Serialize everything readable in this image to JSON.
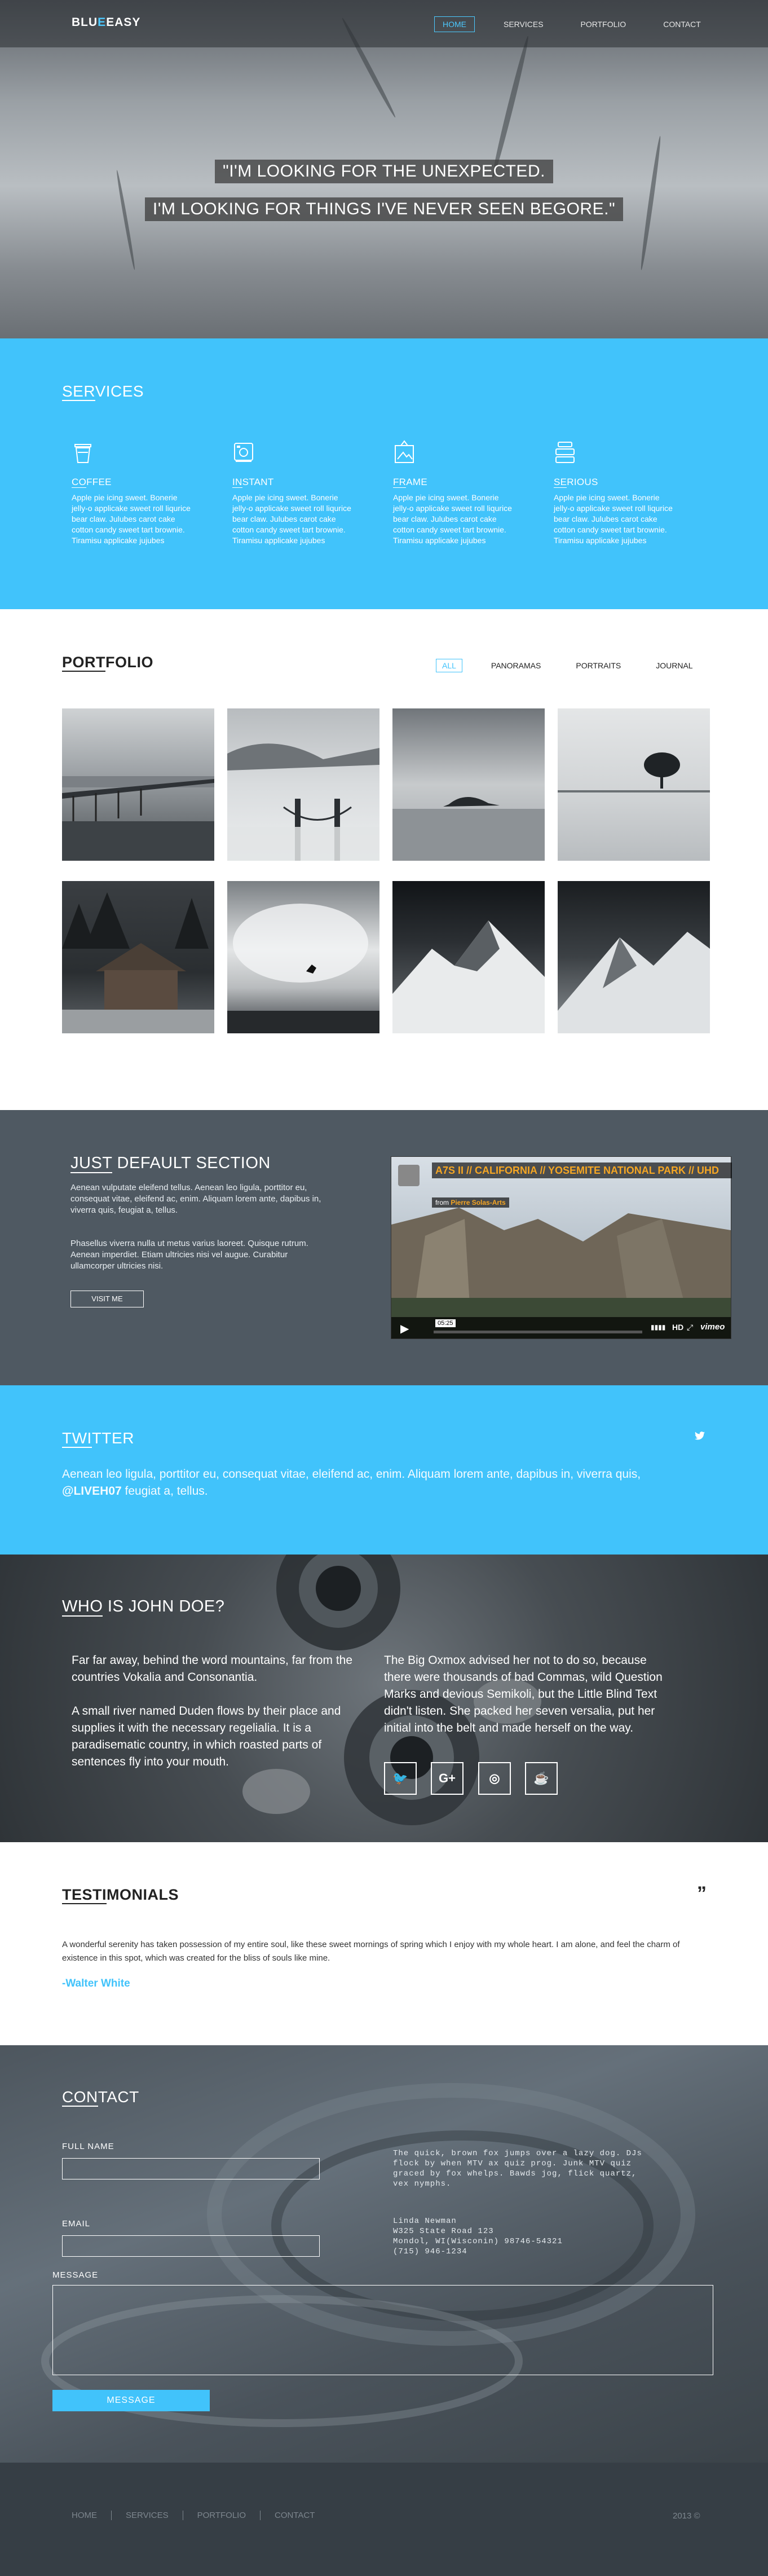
{
  "brand": {
    "logo_part1": "BLU",
    "logo_accent": "E",
    "logo_part2": "EASY",
    "accent_color": "#41c3fb",
    "dark_color": "#4f5962"
  },
  "nav": {
    "items": [
      "HOME",
      "SERVICES",
      "PORTFOLIO",
      "CONTACT"
    ],
    "active": "HOME"
  },
  "hero": {
    "line1": "\"I'M LOOKING FOR THE UNEXPECTED.",
    "line2": "I'M LOOKING FOR THINGS I'VE NEVER SEEN BEGORE.\""
  },
  "services": {
    "title_ul": "SER",
    "title_rest": "VICES",
    "items": [
      {
        "icon": "coffee-cup-icon",
        "title_ul": "CO",
        "title_rest": "FFEE",
        "text": "Apple pie icing sweet. Bonerie jelly-o applicake sweet roll liqurice bear claw. Julubes carot cake cotton candy sweet tart brownie. Tiramisu applicake jujubes"
      },
      {
        "icon": "camera-icon",
        "title_ul": "IN",
        "title_rest": "STANT",
        "text": "Apple pie icing sweet. Bonerie jelly-o applicake sweet roll liqurice bear claw. Julubes carot cake cotton candy sweet tart brownie. Tiramisu applicake jujubes"
      },
      {
        "icon": "frame-icon",
        "title_ul": "FR",
        "title_rest": "AME",
        "text": "Apple pie icing sweet. Bonerie jelly-o applicake sweet roll liqurice bear claw. Julubes carot cake cotton candy sweet tart brownie. Tiramisu applicake jujubes"
      },
      {
        "icon": "stack-icon",
        "title_ul": "SE",
        "title_rest": "RIOUS",
        "text": "Apple pie icing sweet. Bonerie jelly-o applicake sweet roll liqurice bear claw. Julubes carot cake cotton candy sweet tart brownie. Tiramisu applicake jujubes"
      }
    ]
  },
  "portfolio": {
    "title_ul": "PORT",
    "title_rest": "FOLIO",
    "filters": [
      "ALL",
      "PANORAMAS",
      "PORTRAITS",
      "JOURNAL"
    ],
    "active_filter": "ALL",
    "images": [
      "pier-landscape",
      "golden-gate-fog",
      "island-lake",
      "tree-lake",
      "cabin-forest",
      "surfer-wave",
      "snowy-peaks-1",
      "snowy-peaks-2"
    ]
  },
  "default_section": {
    "title_ul": "JUST",
    "title_rest": " DEFAULT SECTION",
    "p1": "Aenean vulputate eleifend tellus. Aenean leo ligula, porttitor eu, consequat vitae, eleifend ac, enim. Aliquam lorem ante, dapibus in, viverra quis, feugiat a, tellus.",
    "p2": "Phasellus viverra nulla ut metus varius laoreet. Quisque rutrum. Aenean imperdiet. Etiam ultricies nisi vel augue. Curabitur ullamcorper ultricies nisi.",
    "button": "VISIT ME",
    "video": {
      "title": "A7S II // CALIFORNIA // YOSEMITE NATIONAL PARK // UHD",
      "from_label": "from",
      "author": "Pierre Solas-Arts",
      "time": "05:25",
      "hd": "HD",
      "brand": "vimeo"
    }
  },
  "twitter": {
    "title_ul": "TWI",
    "title_rest": "TTER",
    "tweet_before": "Aenean leo ligula, porttitor eu, consequat vitae, eleifend ac, enim. Aliquam lorem ante, dapibus in, viverra quis,",
    "tweet_handle": "@LIVEH07",
    "tweet_after": " feugiat a, tellus."
  },
  "about": {
    "title_ul": "WHO",
    "title_rest": " IS JOHN DOE?",
    "col1_p1": "Far far away, behind the word mountains, far from the countries Vokalia and Consonantia.",
    "col1_p2": "A small river named Duden flows by their place and supplies it with the necessary regelialia. It is a paradisematic country, in which roasted parts of sentences fly into your mouth.",
    "col2_p1": "The Big Oxmox advised her not to do so, because there were thousands of bad Commas, wild Question Marks and devious Semikoli, but the Little Blind Text didn't listen. She packed her seven versalia, put her initial into the belt and made herself on the way.",
    "socials": [
      {
        "icon": "twitter-icon",
        "glyph": "🐦"
      },
      {
        "icon": "google-plus-icon",
        "glyph": "G+"
      },
      {
        "icon": "dribbble-icon",
        "glyph": "◎"
      },
      {
        "icon": "coffee-icon",
        "glyph": "☕"
      }
    ]
  },
  "testimonials": {
    "title_ul": "TESTI",
    "title_rest": "MONIALS",
    "quote_glyph": "”",
    "text": "A wonderful serenity has taken possession of my entire soul, like these sweet mornings of spring which I enjoy with my whole heart. I am alone, and feel the charm of existence in this spot, which was created for the bliss of souls like mine.",
    "author": "-Walter White"
  },
  "contact": {
    "title_ul": "CON",
    "title_rest": "TACT",
    "full_name_label": "FULL NAME",
    "email_label": "EMAIL",
    "message_label": "MESSAGE",
    "blurb": "The quick, brown fox jumps over a lazy dog. DJs flock by when MTV ax quiz prog. Junk MTV quiz graced by fox whelps. Bawds jog, flick quartz, vex nymphs.",
    "address_lines": [
      "Linda Newman",
      "W325 State Road 123",
      "Mondol, WI(Wisconin) 98746-54321",
      "(715) 946-1234"
    ],
    "send_label": "MESSAGE"
  },
  "footer": {
    "items": [
      "HOME",
      "SERVICES",
      "PORTFOLIO",
      "CONTACT"
    ],
    "copyright": "2013 ©"
  }
}
